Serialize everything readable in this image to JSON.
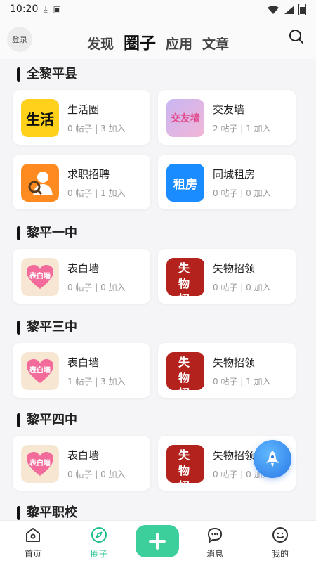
{
  "status_bar": {
    "time": "10:20"
  },
  "header": {
    "login_label": "登录",
    "tabs": [
      {
        "label": "发现",
        "active": false
      },
      {
        "label": "圈子",
        "active": true
      },
      {
        "label": "应用",
        "active": false
      },
      {
        "label": "文章",
        "active": false
      }
    ]
  },
  "sections": [
    {
      "title": "全黎平县",
      "cards": [
        {
          "name": "生活圈",
          "stats": "0 帖子 | 3 加入",
          "icon": "life-circle-icon",
          "icon_text": "生活"
        },
        {
          "name": "交友墙",
          "stats": "2 帖子 | 1 加入",
          "icon": "friend-wall-icon",
          "icon_text": "交友墙"
        },
        {
          "name": "求职招聘",
          "stats": "0 帖子 | 1 加入",
          "icon": "job-search-icon",
          "icon_text": ""
        },
        {
          "name": "同城租房",
          "stats": "0 帖子 | 0 加入",
          "icon": "rent-icon",
          "icon_text": "租房"
        }
      ]
    },
    {
      "title": "黎平一中",
      "cards": [
        {
          "name": "表白墙",
          "stats": "0 帖子 | 0 加入",
          "icon": "confession-heart-icon",
          "icon_text": "表白墙"
        },
        {
          "name": "失物招领",
          "stats": "0 帖子 | 0 加入",
          "icon": "lost-found-icon",
          "icon_text": "失物招领"
        }
      ]
    },
    {
      "title": "黎平三中",
      "cards": [
        {
          "name": "表白墙",
          "stats": "1 帖子 | 3 加入",
          "icon": "confession-heart-icon",
          "icon_text": "表白墙"
        },
        {
          "name": "失物招领",
          "stats": "0 帖子 | 1 加入",
          "icon": "lost-found-icon",
          "icon_text": "失物招领"
        }
      ]
    },
    {
      "title": "黎平四中",
      "cards": [
        {
          "name": "表白墙",
          "stats": "0 帖子 | 0 加入",
          "icon": "confession-heart-icon",
          "icon_text": "表白墙"
        },
        {
          "name": "失物招领",
          "stats": "0 帖子 | 0 加入",
          "icon": "lost-found-icon",
          "icon_text": "失物招领"
        }
      ]
    },
    {
      "title": "黎平职校",
      "cards": []
    }
  ],
  "bottom_nav": [
    {
      "label": "首页",
      "icon": "home-icon",
      "active": false
    },
    {
      "label": "圈子",
      "icon": "compass-icon",
      "active": true
    },
    {
      "label": "消息",
      "icon": "message-icon",
      "active": false
    },
    {
      "label": "我的",
      "icon": "profile-icon",
      "active": false
    }
  ],
  "colors": {
    "accent": "#3ccf9c",
    "active_nav": "#1fbf8f",
    "fab": "#2a78e6"
  }
}
